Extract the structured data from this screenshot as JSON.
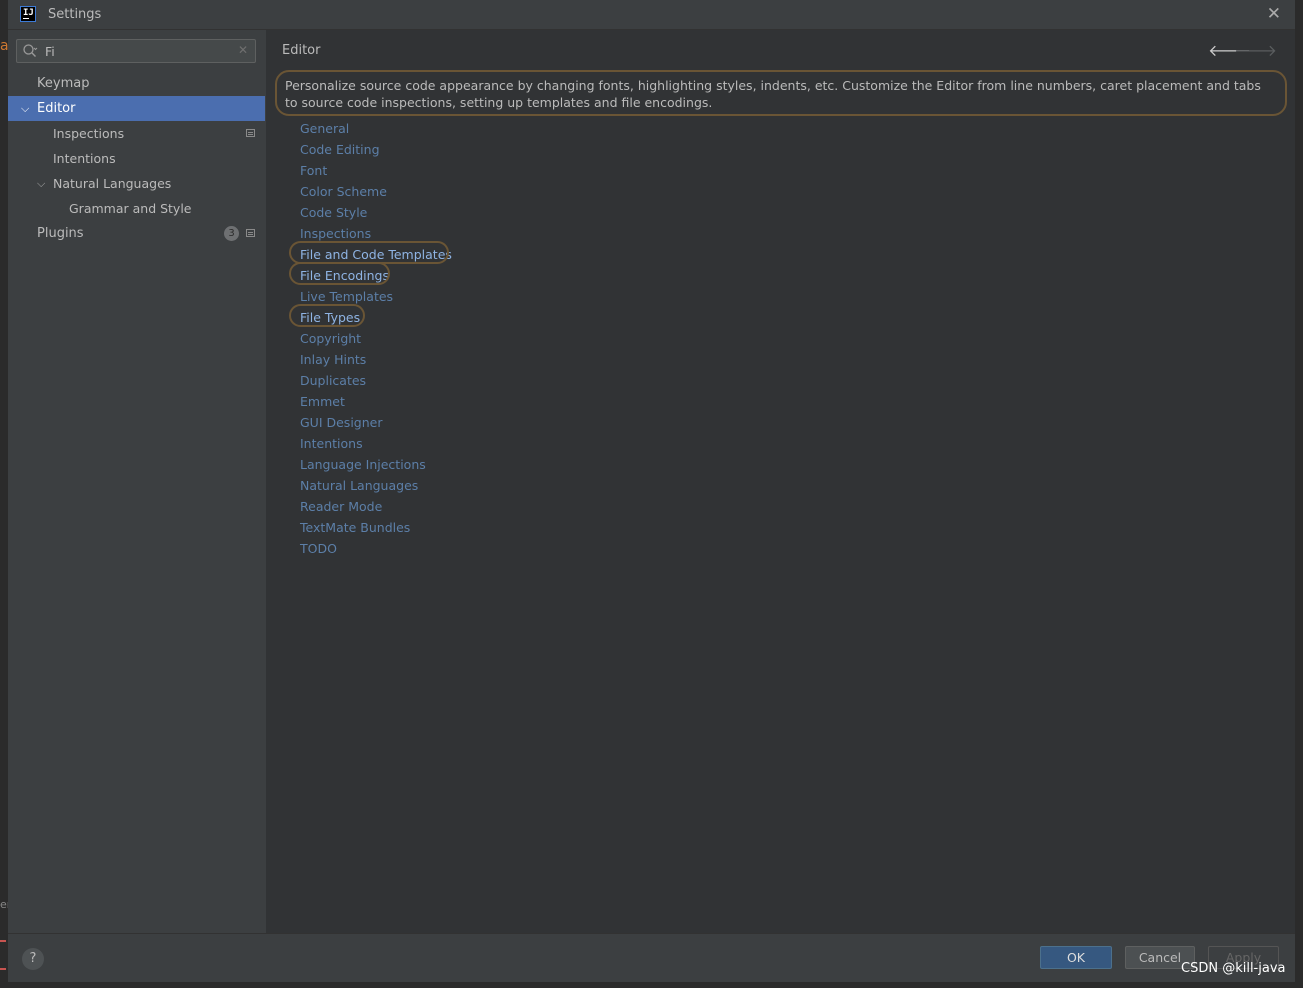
{
  "window": {
    "title": "Settings",
    "app_icon_text": "IJ"
  },
  "search": {
    "value": "Fi",
    "clear_glyph": "✕"
  },
  "background_ide": {
    "edge_char_top": "a",
    "edge_char_bottom": "er"
  },
  "sidebar": {
    "items": [
      {
        "label": "Keymap"
      },
      {
        "label": "Editor",
        "selected": true,
        "expanded": true
      },
      {
        "label": "Inspections",
        "project_scoped": true
      },
      {
        "label": "Intentions"
      },
      {
        "label": "Natural Languages",
        "expanded": true
      },
      {
        "label": "Grammar and Style"
      },
      {
        "label": "Plugins",
        "badge": "3",
        "project_scoped": true
      }
    ]
  },
  "main": {
    "title": "Editor",
    "description": "Personalize source code appearance by changing fonts, highlighting styles, indents, etc. Customize the Editor from line numbers, caret placement and tabs to source code inspections, setting up templates and file encodings.",
    "links": [
      {
        "label": "General"
      },
      {
        "label": "Code Editing"
      },
      {
        "label": "Font"
      },
      {
        "label": "Color Scheme"
      },
      {
        "label": "Code Style"
      },
      {
        "label": "Inspections"
      },
      {
        "label": "File and Code Templates",
        "highlighted": true
      },
      {
        "label": "File Encodings",
        "highlighted": true
      },
      {
        "label": "Live Templates"
      },
      {
        "label": "File Types",
        "highlighted": true
      },
      {
        "label": "Copyright"
      },
      {
        "label": "Inlay Hints"
      },
      {
        "label": "Duplicates"
      },
      {
        "label": "Emmet"
      },
      {
        "label": "GUI Designer"
      },
      {
        "label": "Intentions"
      },
      {
        "label": "Language Injections"
      },
      {
        "label": "Natural Languages"
      },
      {
        "label": "Reader Mode"
      },
      {
        "label": "TextMate Bundles"
      },
      {
        "label": "TODO"
      }
    ]
  },
  "buttons": {
    "help": "?",
    "ok": "OK",
    "cancel": "Cancel",
    "apply": "Apply"
  },
  "watermark": "CSDN @kill-java",
  "colors": {
    "selection": "#4b6eaf",
    "link": "#5c7fa8",
    "highlight_ring": "#6a5535",
    "ok_button": "#365880"
  }
}
